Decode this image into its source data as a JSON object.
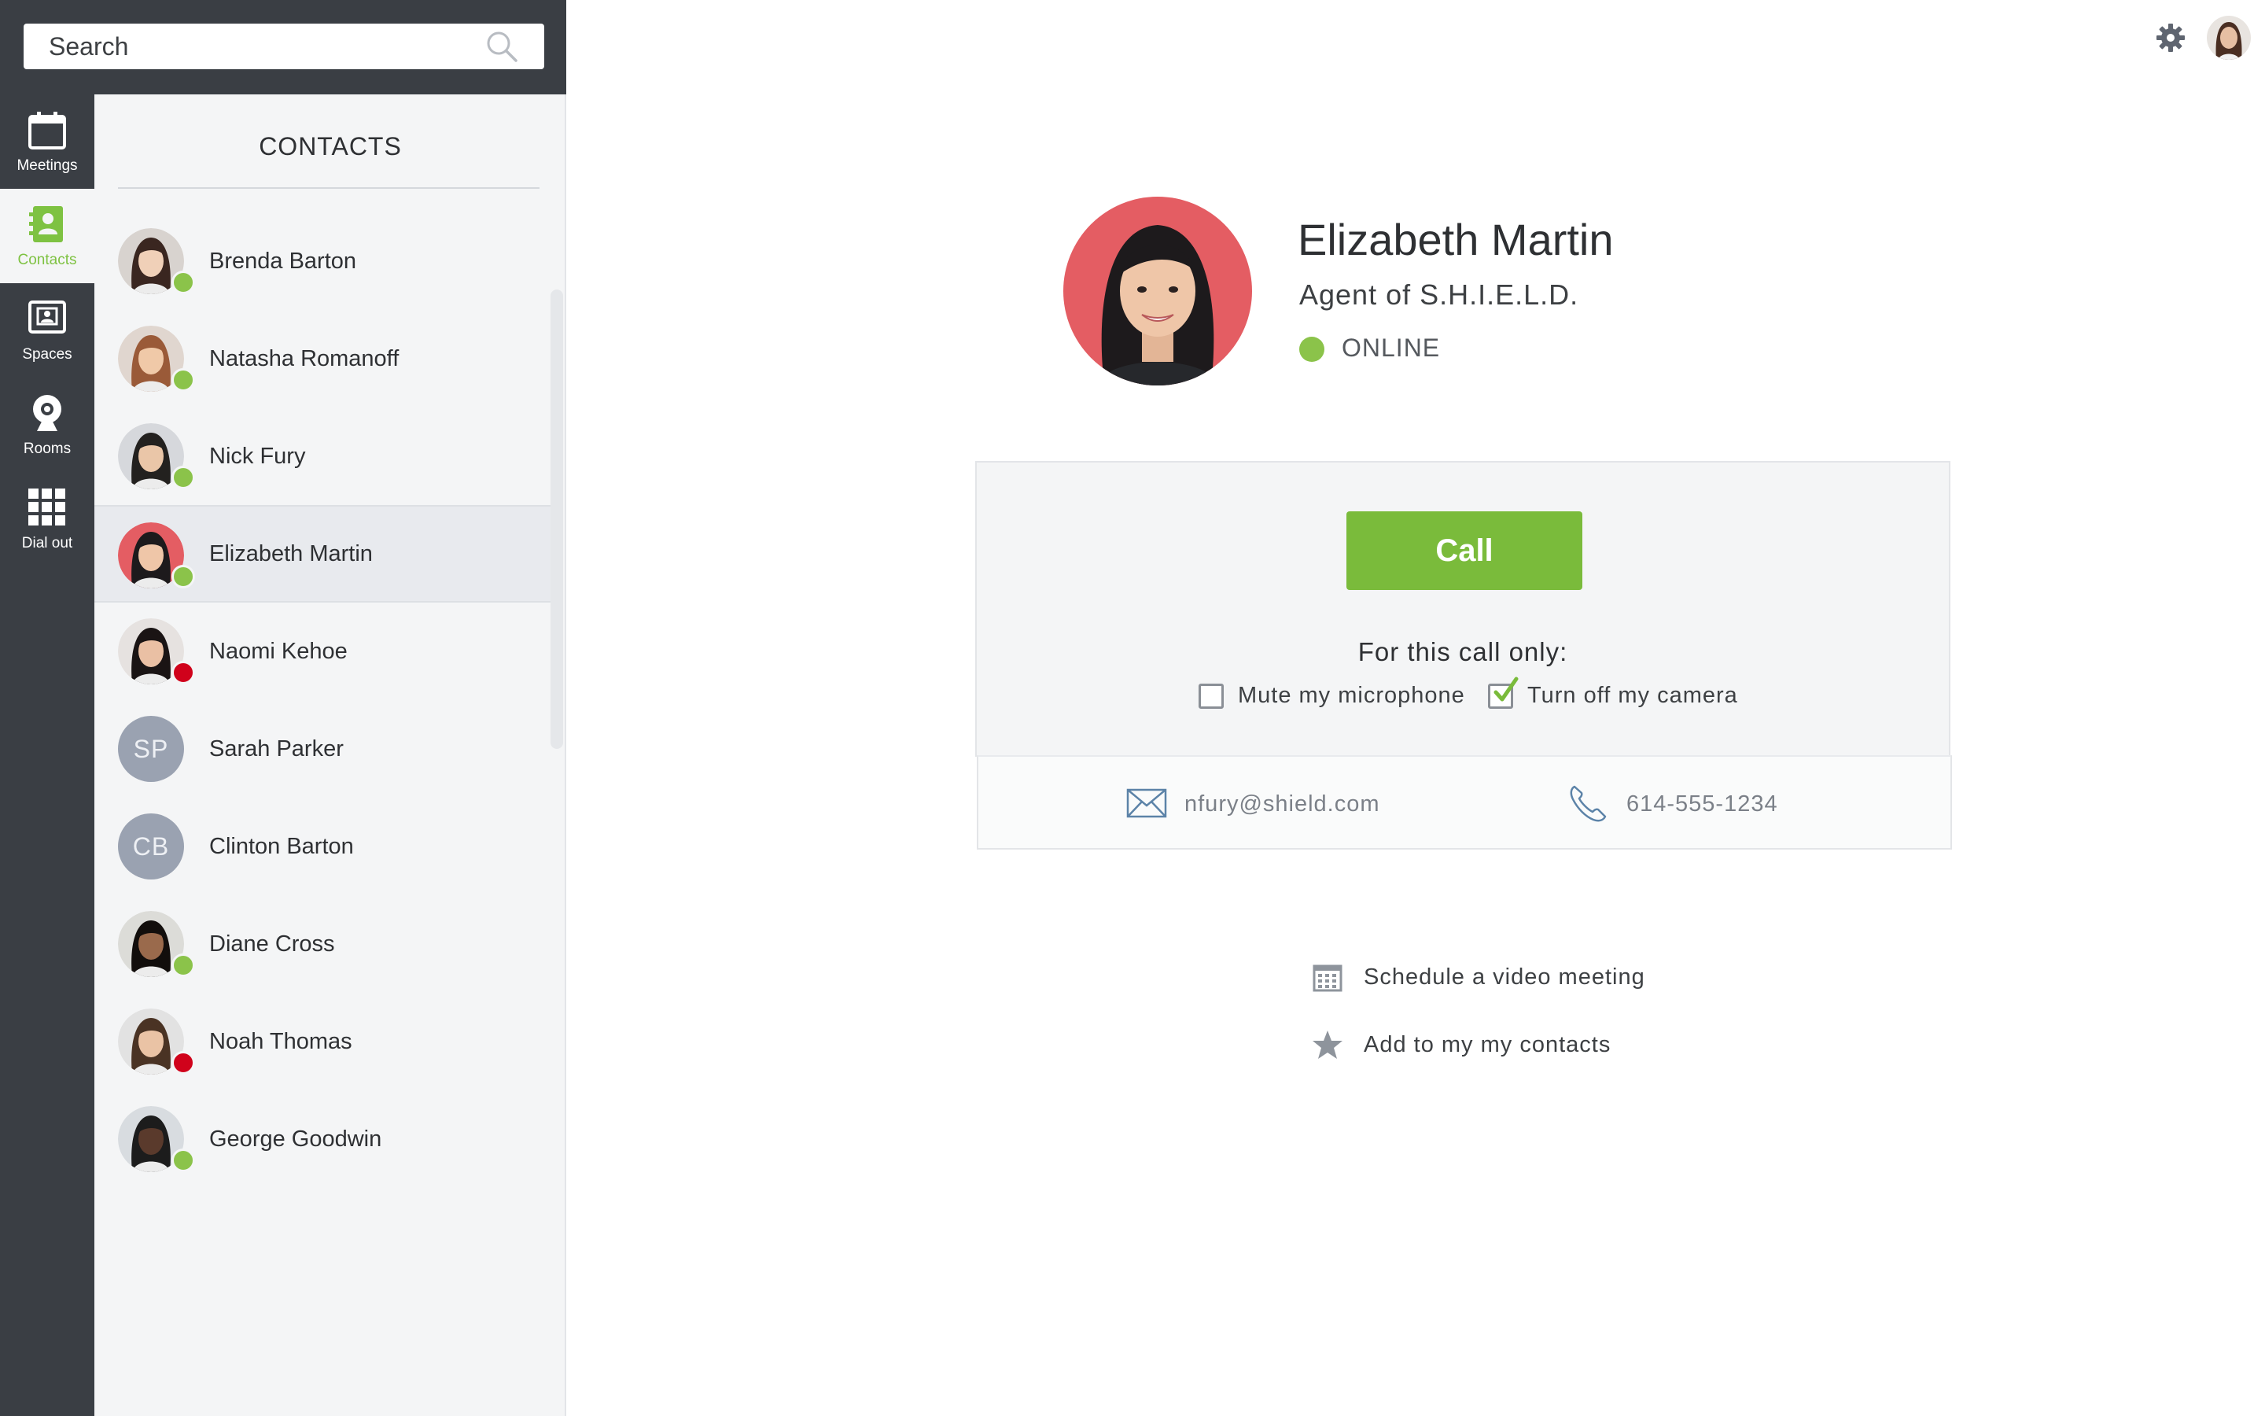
{
  "search": {
    "placeholder": "Search"
  },
  "rail": {
    "items": [
      {
        "label": "Meetings",
        "icon": "calendar-icon",
        "active": false
      },
      {
        "label": "Contacts",
        "icon": "address-book-icon",
        "active": true
      },
      {
        "label": "Spaces",
        "icon": "spaces-icon",
        "active": false
      },
      {
        "label": "Rooms",
        "icon": "webcam-icon",
        "active": false
      },
      {
        "label": "Dial out",
        "icon": "dialpad-icon",
        "active": false
      }
    ]
  },
  "contacts": {
    "title": "CONTACTS",
    "items": [
      {
        "name": "Brenda Barton",
        "status": "online",
        "initials": ""
      },
      {
        "name": "Natasha Romanoff",
        "status": "online",
        "initials": ""
      },
      {
        "name": "Nick Fury",
        "status": "online",
        "initials": ""
      },
      {
        "name": "Elizabeth Martin",
        "status": "online",
        "initials": "",
        "selected": true
      },
      {
        "name": "Naomi Kehoe",
        "status": "busy",
        "initials": ""
      },
      {
        "name": "Sarah Parker",
        "status": "none",
        "initials": "SP"
      },
      {
        "name": "Clinton Barton",
        "status": "none",
        "initials": "CB"
      },
      {
        "name": "Diane Cross",
        "status": "online",
        "initials": ""
      },
      {
        "name": "Noah Thomas",
        "status": "busy",
        "initials": ""
      },
      {
        "name": "George Goodwin",
        "status": "online",
        "initials": ""
      }
    ]
  },
  "profile": {
    "name": "Elizabeth Martin",
    "title": "Agent of S.H.I.E.L.D.",
    "status": "ONLINE"
  },
  "call": {
    "button_label": "Call",
    "options_heading": "For this call only:",
    "mute_label": "Mute my microphone",
    "mute_checked": false,
    "camera_label": "Turn off my camera",
    "camera_checked": true
  },
  "contact_info": {
    "email": "nfury@shield.com",
    "phone": "614-555-1234"
  },
  "actions": {
    "schedule_label": "Schedule a video meeting",
    "add_label": "Add to my my contacts"
  },
  "colors": {
    "accent_green": "#7abb3b",
    "online": "#8bc34a",
    "busy": "#d0021b",
    "rail_bg": "#3a3e44"
  }
}
